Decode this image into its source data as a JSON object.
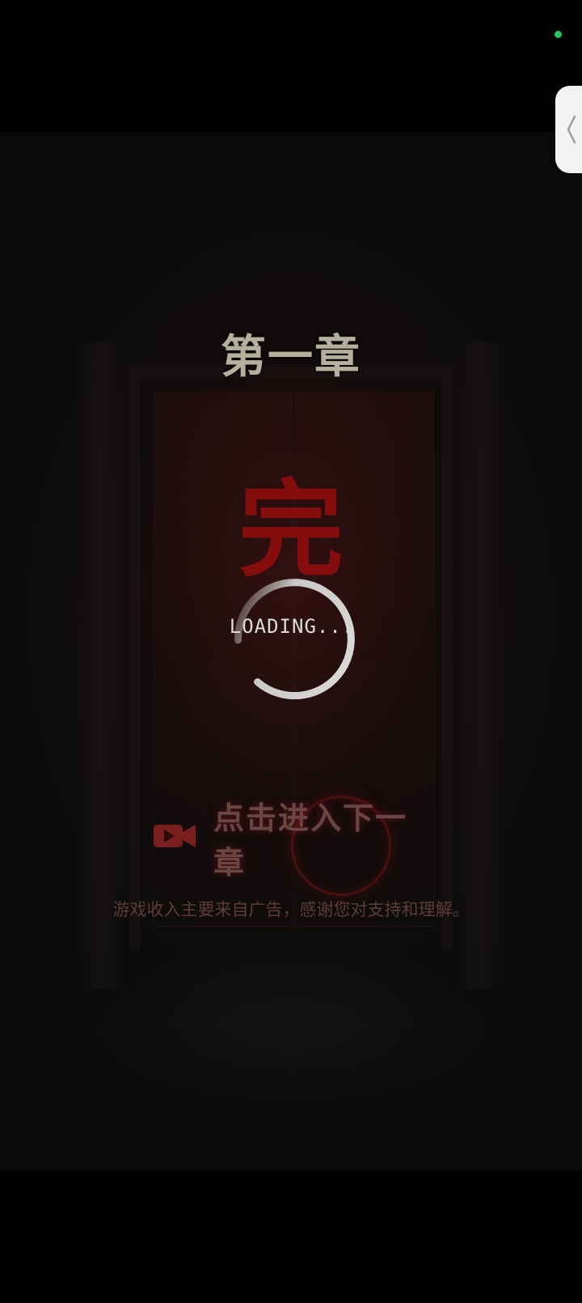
{
  "game": {
    "chapter_title": "第一章",
    "end_char": "完",
    "loading_text": "LOADING...",
    "next_chapter_label": "点击进入下一章",
    "ad_notice": "游戏收入主要来自广告，感谢您对支持和理解。"
  },
  "icons": {
    "side_tab": "chevron-left-icon",
    "video": "video-camera-icon"
  },
  "colors": {
    "status_dot": "#22c55e",
    "title": "#b5b09c",
    "end_char": "#8a0d0d",
    "loader": "#dcdcdc",
    "next_label": "#6b4444",
    "notice": "#5e3a3a"
  }
}
